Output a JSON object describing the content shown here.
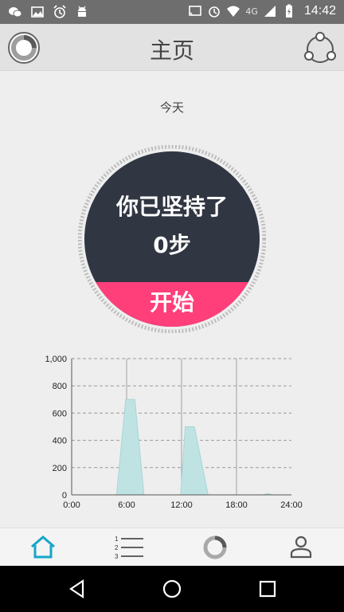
{
  "status_bar": {
    "time": "14:42",
    "network": "4G",
    "icons": [
      "wechat-icon",
      "image-icon",
      "alarm-icon",
      "android-icon",
      "cast-icon",
      "alarm-icon",
      "wifi-icon",
      "signal-icon",
      "battery-icon"
    ]
  },
  "header": {
    "title": "主页",
    "left_icon": "ring-progress-icon",
    "right_icon": "share-icon"
  },
  "date_label": "今天",
  "dial": {
    "line1": "你已坚持了",
    "line2": "0步",
    "start_label": "开始",
    "colors": {
      "body": "#303642",
      "start": "#ff3f7a",
      "ring": "#bdbdbd"
    }
  },
  "chart_data": {
    "type": "area",
    "x_ticks": [
      "0:00",
      "6:00",
      "12:00",
      "18:00",
      "24:00"
    ],
    "y_ticks": [
      "0",
      "200",
      "400",
      "600",
      "800",
      "1,000"
    ],
    "ylim": [
      0,
      1000
    ],
    "xlim": [
      0,
      24
    ],
    "grid": true,
    "color": "#bfe3e3",
    "x": [
      0,
      4.9,
      5.9,
      6.9,
      7.9,
      11.9,
      12.4,
      13.4,
      14.9,
      20.9,
      21.4,
      21.9,
      24
    ],
    "values": [
      0,
      0,
      700,
      700,
      0,
      0,
      500,
      500,
      0,
      0,
      10,
      0,
      0
    ]
  },
  "nav": {
    "items": [
      {
        "name": "home",
        "icon": "home-icon",
        "active": true
      },
      {
        "name": "list",
        "icon": "list-icon",
        "active": false
      },
      {
        "name": "stats",
        "icon": "ring-icon",
        "active": false
      },
      {
        "name": "profile",
        "icon": "person-icon",
        "active": false
      }
    ]
  },
  "system_nav": [
    "back-icon",
    "home-circle-icon",
    "recents-icon"
  ]
}
